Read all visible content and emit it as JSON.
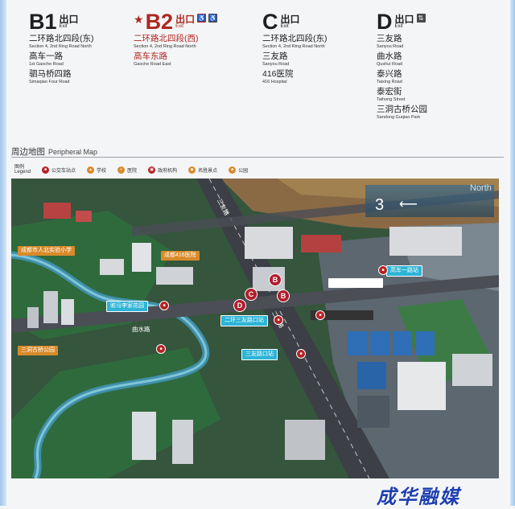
{
  "exits": [
    {
      "letter": "B1",
      "label_cn": "出口",
      "label_en": "Exit",
      "has_icon": false,
      "roads": [
        {
          "cn": "二环路北四段(东)",
          "en": "Section 4, 2nd Ring Road North"
        },
        {
          "cn": "高车一路",
          "en": "1st Gaoche Road"
        },
        {
          "cn": "驷马桥四路",
          "en": "Simaqiao Four Road"
        }
      ]
    },
    {
      "letter": "B2",
      "label_cn": "出口",
      "label_en": "Exit",
      "has_icon": true,
      "icons": [
        "toilet-icon",
        "accessible-icon"
      ],
      "roads": [
        {
          "cn": "二环路北四段(西)",
          "en": "Section 4, 2nd Ring Road North"
        },
        {
          "cn": "高车东路",
          "en": "Gaoche Road East"
        }
      ]
    },
    {
      "letter": "C",
      "label_cn": "出口",
      "label_en": "Exit",
      "has_icon": false,
      "roads": [
        {
          "cn": "二环路北四段(东)",
          "en": "Section 4, 2nd Ring Road North"
        },
        {
          "cn": "三友路",
          "en": "Sanyou Road"
        },
        {
          "cn": "416医院",
          "en": "416 Hospital"
        }
      ]
    },
    {
      "letter": "D",
      "label_cn": "出口",
      "label_en": "Exit",
      "has_icon": true,
      "icons": [
        "elevator-icon"
      ],
      "roads": [
        {
          "cn": "三友路",
          "en": "Sanyou Road"
        },
        {
          "cn": "曲水路",
          "en": "Qushui Road"
        },
        {
          "cn": "泰兴路",
          "en": "Taixing Road"
        },
        {
          "cn": "泰宏街",
          "en": "Taihong Street"
        },
        {
          "cn": "三洞古桥公园",
          "en": "Sandong Guqiao Park"
        }
      ]
    }
  ],
  "peripheral_map": {
    "title_cn": "周边地图",
    "title_en": "Peripheral Map",
    "legend_title_cn": "图例",
    "legend_title_en": "Legend",
    "legend": [
      {
        "label": "公交车站点",
        "icon": "bus-stop-icon",
        "color": "#b52224"
      },
      {
        "label": "学校",
        "icon": "school-icon",
        "color": "#d88a2a"
      },
      {
        "label": "医院",
        "icon": "hospital-icon",
        "color": "#d88a2a"
      },
      {
        "label": "政府机构",
        "icon": "government-icon",
        "color": "#b52224"
      },
      {
        "label": "名胜景点",
        "icon": "scenic-spot-icon",
        "color": "#d88a2a"
      },
      {
        "label": "公园",
        "icon": "park-icon",
        "color": "#d88a2a"
      }
    ],
    "labels": {
      "school": "成都市人北实验小学",
      "hospital": "成都416医院",
      "park": "三洞古桥公园",
      "bus1": "驸马李家花园",
      "bus2": "二环三友路口站",
      "bus3": "三友路口站",
      "bus4": "高车一路站",
      "road_sanyou": "三友路",
      "road_huanlu": "二环路",
      "road_qushui": "曲水路",
      "road_north": "North",
      "ring_num": "3"
    },
    "exit_markers": [
      "B",
      "B",
      "C",
      "D"
    ]
  },
  "watermark": "成华融媒"
}
